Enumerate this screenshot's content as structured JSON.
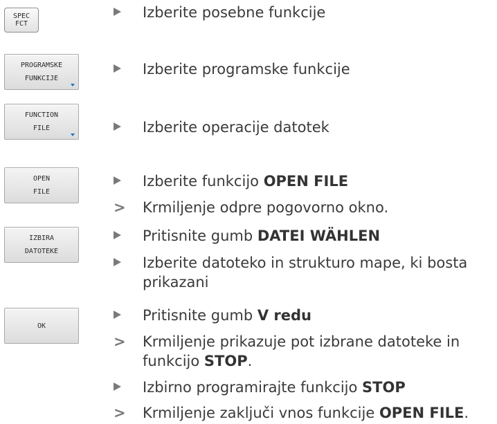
{
  "keys": {
    "spec": [
      "SPEC",
      "FCT"
    ],
    "programske": [
      "PROGRAMSKE",
      "FUNKCIJE"
    ],
    "function_file": [
      "FUNCTION",
      "FILE"
    ],
    "open_file": [
      "OPEN",
      "FILE"
    ],
    "izbira": [
      "IZBIRA",
      "DATOTEKE"
    ],
    "ok": [
      "OK"
    ]
  },
  "steps": [
    {
      "kind": "action",
      "text": "Izberite posebne funkcije"
    },
    {
      "kind": "action",
      "text": "Izberite programske funkcije"
    },
    {
      "kind": "action",
      "text": "Izberite operacije datotek"
    },
    {
      "kind": "action",
      "text": "Izberite funkcijo ",
      "bold": "OPEN FILE",
      "after": ""
    },
    {
      "kind": "result",
      "text": "Krmiljenje odpre pogovorno okno."
    },
    {
      "kind": "action",
      "text": "Pritisnite gumb ",
      "bold": "DATEI WÄHLEN",
      "after": ""
    },
    {
      "kind": "action",
      "text": "Izberite datoteko in strukturo mape, ki bosta",
      "text2": "prikazani"
    },
    {
      "kind": "action",
      "text": "Pritisnite gumb ",
      "bold": "V redu",
      "after": ""
    },
    {
      "kind": "result",
      "text": "Krmiljenje prikazuje pot izbrane datoteke in",
      "text2a": "funkcijo ",
      "bold2": "STOP",
      "after2": "."
    },
    {
      "kind": "action",
      "text": "Izbirno programirajte funkcijo ",
      "bold": "STOP",
      "after": ""
    },
    {
      "kind": "result",
      "text": "Krmiljenje zaključi vnos funkcije ",
      "bold": "OPEN FILE",
      "after": "."
    }
  ]
}
